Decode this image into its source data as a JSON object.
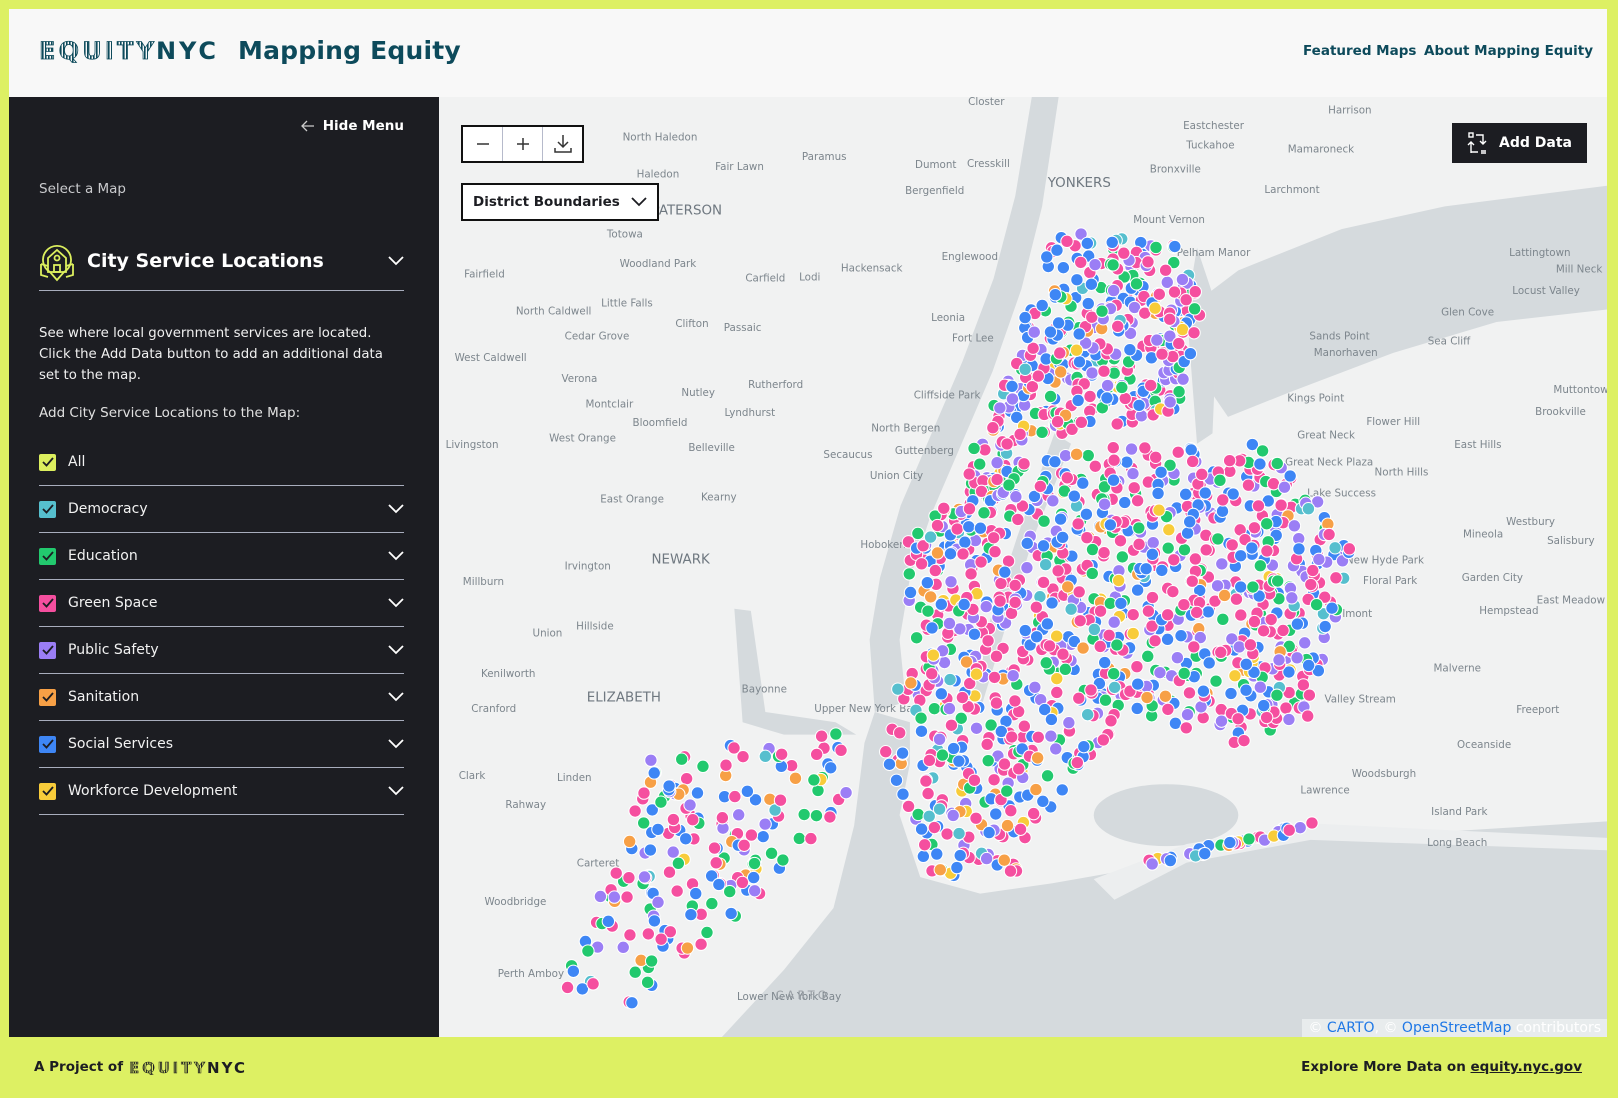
{
  "header": {
    "logo_text": {
      "equity": "EQUITY",
      "nyc": "NYC"
    },
    "title": "Mapping Equity",
    "nav": [
      "Featured Maps",
      "About Mapping Equity"
    ]
  },
  "sidebar": {
    "hide_menu": "Hide Menu",
    "select_label": "Select a Map",
    "selected_map": "City Service Locations",
    "description": "See where local government services are located. Click the Add Data button to add an additional data set to the map.",
    "add_heading": "Add City Service Locations to the Map:",
    "categories": [
      {
        "label": "All",
        "color": "#dcef5e",
        "checked": true
      },
      {
        "label": "Democracy",
        "color": "#56bfce",
        "checked": true
      },
      {
        "label": "Education",
        "color": "#22c96e",
        "checked": true
      },
      {
        "label": "Green Space",
        "color": "#f54f9f",
        "checked": true
      },
      {
        "label": "Public Safety",
        "color": "#9b7ef5",
        "checked": true
      },
      {
        "label": "Sanitation",
        "color": "#f7a046",
        "checked": true
      },
      {
        "label": "Social Services",
        "color": "#3e86f5",
        "checked": true
      },
      {
        "label": "Workforce Development",
        "color": "#f8cc3a",
        "checked": true
      }
    ]
  },
  "map": {
    "boundary_select": "District Boundaries",
    "add_data": "Add Data",
    "attribution": {
      "carto": "CARTO",
      "osm": "OpenStreetMap",
      "suffix": "contributors"
    },
    "watermark": "CARTO",
    "labels": [
      "Closter",
      "Harrison",
      "Eastchester",
      "North Haledon",
      "Tuckahoe",
      "Paramus",
      "Mamaroneck",
      "Fair Lawn",
      "Dumont",
      "Cresskill",
      "Bronxville",
      "Haledon",
      "Bergenfield",
      "YONKERS",
      "Larchmont",
      "PATERSON",
      "Totowa",
      "Mount Vernon",
      "Lattingtown",
      "Englewood",
      "Pelham Manor",
      "Woodland Park",
      "Hackensack",
      "Carfield",
      "Lodi",
      "Mill Neck",
      "Fairfield",
      "Locust Valley",
      "Little Falls",
      "Glen Cove",
      "North Caldwell",
      "Clifton",
      "Passaic",
      "Leonia",
      "Cedar Grove",
      "Sands Point",
      "Sea Cliff",
      "Fort Lee",
      "Manorhaven",
      "West Caldwell",
      "Verona",
      "Rutherford",
      "Nutley",
      "Cliffside Park",
      "Kings Point",
      "Muttontown",
      "Montclair",
      "Lyndhurst",
      "Brookville",
      "Bloomfield",
      "North Bergen",
      "Flower Hill",
      "Great Neck",
      "Livingston",
      "West Orange",
      "Belleville",
      "Guttenberg",
      "Secaucus",
      "East Hills",
      "Great Neck Plaza",
      "Union City",
      "North Hills",
      "Lake Success",
      "East Orange",
      "Kearny",
      "Westbury",
      "Hoboken",
      "Mineola",
      "Salisbury",
      "New Hyde Park",
      "Irvington",
      "NEWARK",
      "Garden City",
      "Floral Park",
      "Millburn",
      "East Meadow",
      "Hempstead",
      "Elmont",
      "Hillside",
      "Union",
      "Malverne",
      "Kenilworth",
      "Bayonne",
      "Valley Stream",
      "ELIZABETH",
      "Cranford",
      "Freeport",
      "Upper New York Bay",
      "Oceanside",
      "Clark",
      "Linden",
      "Woodsburgh",
      "Lawrence",
      "Rahway",
      "Island Park",
      "Long Beach",
      "Carteret",
      "Woodbridge",
      "Perth Amboy",
      "Lower New York Bay"
    ]
  },
  "footer": {
    "project_of": "A Project of",
    "explore": "Explore More Data on",
    "link": "equity.nyc.gov"
  }
}
